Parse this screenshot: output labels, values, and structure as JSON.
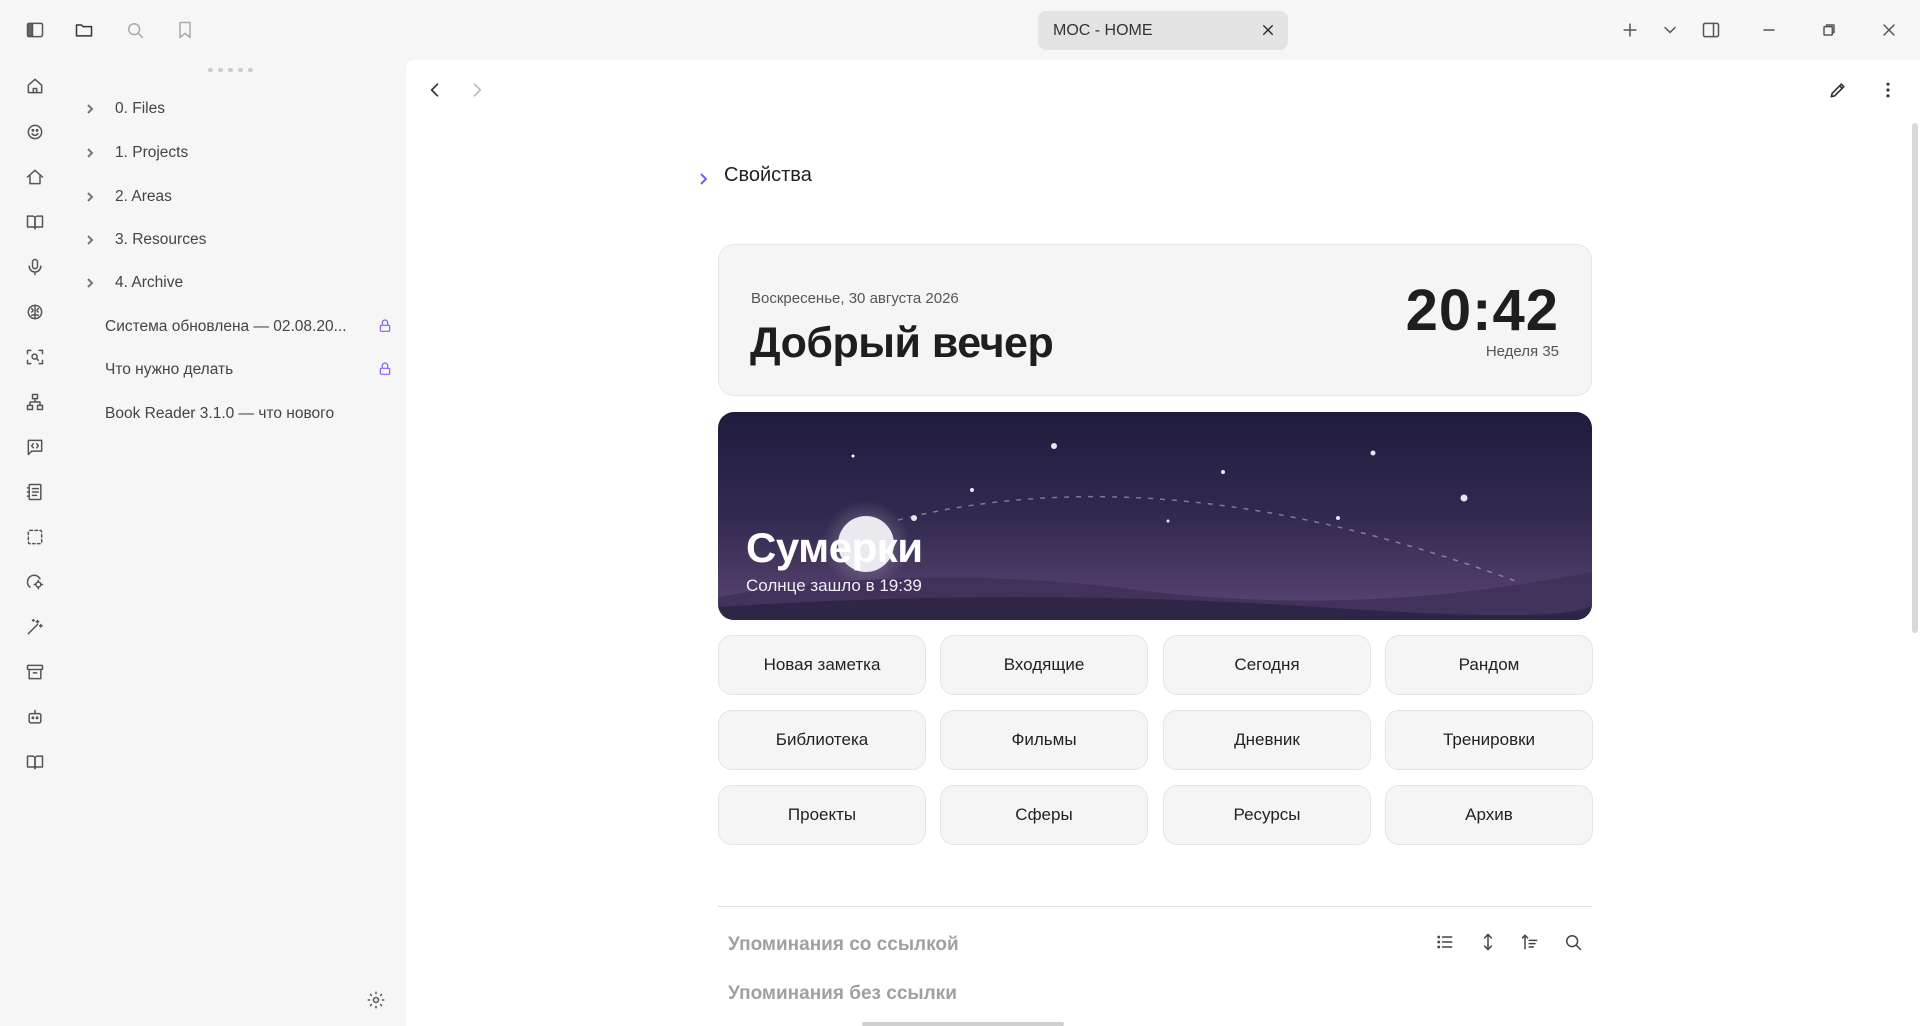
{
  "window": {
    "tab_title": "MOC - HOME"
  },
  "sidebar": {
    "folders": [
      {
        "label": "0. Files"
      },
      {
        "label": "1. Projects"
      },
      {
        "label": "2. Areas"
      },
      {
        "label": "3. Resources"
      },
      {
        "label": "4. Archive"
      }
    ],
    "files": [
      {
        "label": "Система обновлена — 02.08.20...",
        "locked": true
      },
      {
        "label": "Что нужно делать",
        "locked": true
      },
      {
        "label": "Book Reader 3.1.0 — что нового",
        "locked": false
      }
    ]
  },
  "note": {
    "properties_label": "Свойства",
    "greeting": {
      "date": "Воскресенье, 30 августа 2026",
      "title": "Добрый вечер",
      "time": "20:42",
      "week": "Неделя 35"
    },
    "sky": {
      "title": "Сумерки",
      "subtitle": "Солнце зашло в 19:39"
    },
    "buttons": [
      [
        "Новая заметка",
        "Входящие",
        "Сегодня",
        "Рандом"
      ],
      [
        "Библиотека",
        "Фильмы",
        "Дневник",
        "Тренировки"
      ],
      [
        "Проекты",
        "Сферы",
        "Ресурсы",
        "Архив"
      ]
    ],
    "linked_mentions": "Упоминания со ссылкой",
    "unlinked_mentions": "Упоминания без ссылки"
  },
  "colors": {
    "accent": "#8a5cf5",
    "sky_top": "#1e1c3d",
    "sky_bottom": "#5a4675"
  }
}
